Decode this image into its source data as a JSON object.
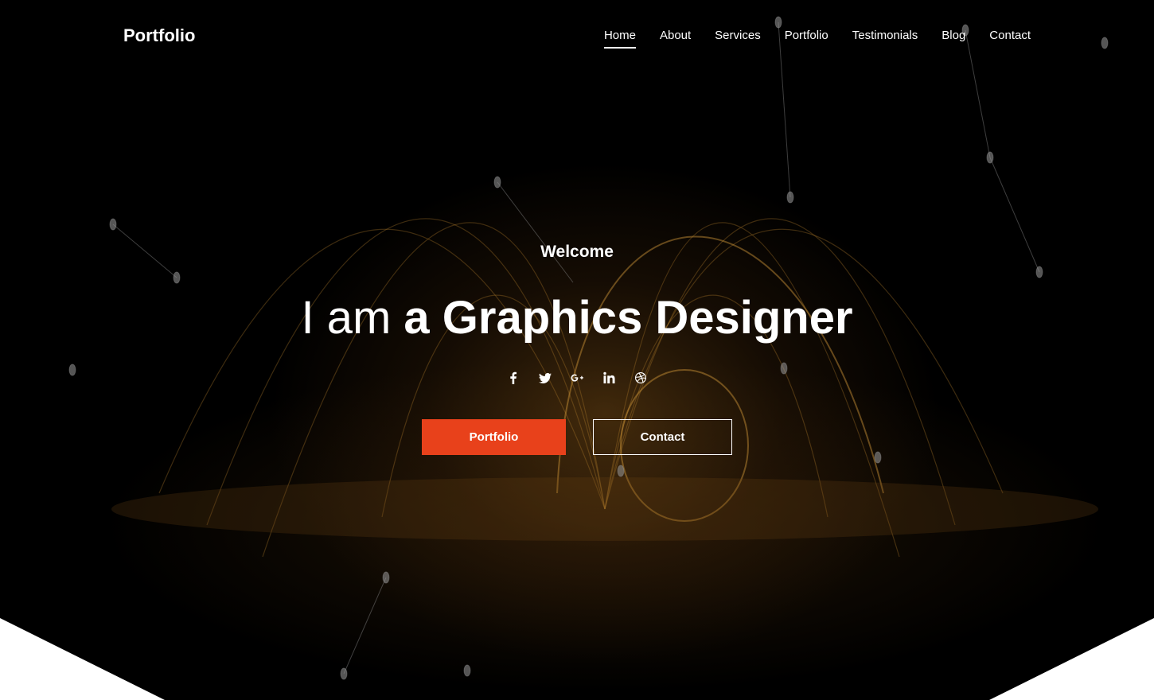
{
  "brand": "Portfolio",
  "nav": {
    "items": [
      "Home",
      "About",
      "Services",
      "Portfolio",
      "Testimonials",
      "Blog",
      "Contact"
    ],
    "active": "Home"
  },
  "hero": {
    "welcome": "Welcome",
    "headline_light": "I am",
    "headline_bold": "a Graphics Designer"
  },
  "social_icons": [
    "facebook-icon",
    "twitter-icon",
    "google-plus-icon",
    "linkedin-icon",
    "dribbble-icon"
  ],
  "buttons": {
    "primary_label": "Portfolio",
    "secondary_label": "Contact"
  },
  "colors": {
    "accent": "#e8411b",
    "text": "#ffffff",
    "background": "#000000"
  }
}
